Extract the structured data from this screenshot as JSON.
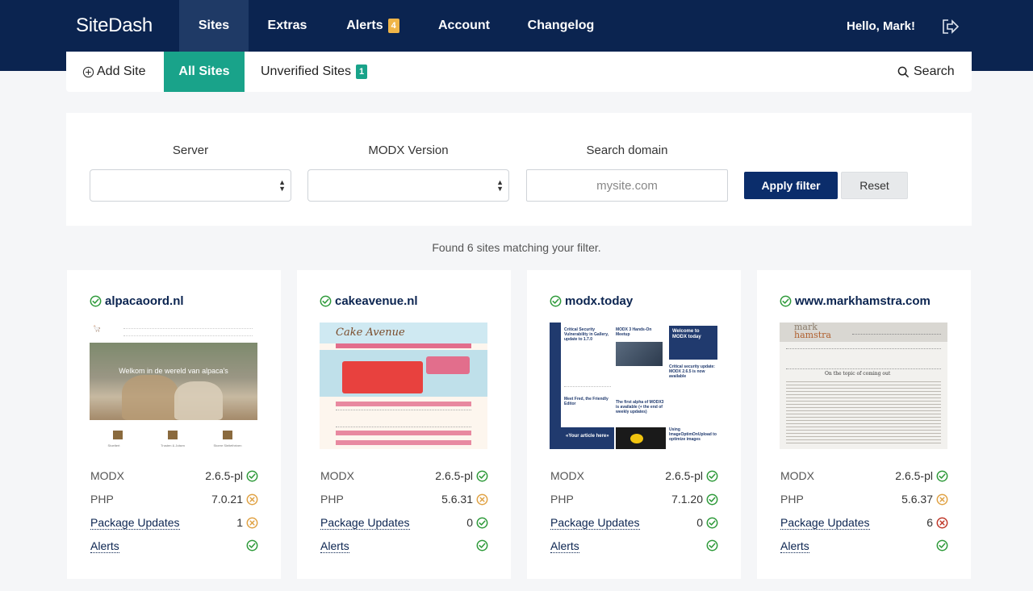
{
  "header": {
    "brand": "SiteDash",
    "nav": [
      {
        "label": "Sites",
        "active": true
      },
      {
        "label": "Extras"
      },
      {
        "label": "Alerts",
        "badge": "4"
      },
      {
        "label": "Account"
      },
      {
        "label": "Changelog"
      }
    ],
    "greeting": "Hello, Mark!"
  },
  "subnav": {
    "add_site": "Add Site",
    "all_sites": "All Sites",
    "unverified": "Unverified Sites",
    "unverified_count": "1",
    "search": "Search"
  },
  "filter": {
    "server_label": "Server",
    "modx_label": "MODX Version",
    "domain_label": "Search domain",
    "domain_placeholder": "mysite.com",
    "apply": "Apply filter",
    "reset": "Reset"
  },
  "found_text": "Found 6 sites matching your filter.",
  "row_labels": {
    "modx": "MODX",
    "php": "PHP",
    "updates": "Package Updates",
    "alerts": "Alerts"
  },
  "sites": [
    {
      "domain": "alpacaoord.nl",
      "modx": "2.6.5-pl",
      "modx_status": "ok",
      "php": "7.0.21",
      "php_status": "warn",
      "updates": "1",
      "updates_status": "warn",
      "alerts_status": "ok",
      "thumb_text": [
        "Welkom in de wereld van alpaca's",
        "Stoeltert",
        "Trusten & Jolsen",
        "Stoere Sleitethriven"
      ]
    },
    {
      "domain": "cakeavenue.nl",
      "modx": "2.6.5-pl",
      "modx_status": "ok",
      "php": "5.6.31",
      "php_status": "warn",
      "updates": "0",
      "updates_status": "ok",
      "alerts_status": "ok",
      "thumb_text": [
        "Cake Avenue"
      ]
    },
    {
      "domain": "modx.today",
      "modx": "2.6.5-pl",
      "modx_status": "ok",
      "php": "7.1.20",
      "php_status": "ok",
      "updates": "0",
      "updates_status": "ok",
      "alerts_status": "ok",
      "thumb_text": [
        "Critical Security Vulnerability in Gallery, update to 1.7.0",
        "MODX 3 Hands-On Meetup",
        "Welcome to MODX today",
        "Critical security update: MODX 2.6.5 is now available",
        "Meet Fred, the Friendly Editor",
        "The first alpha of MODX3 is available (+ the end of weekly updates)",
        "«Your article here»",
        "Using ImageOptimOnUpload to optimize images"
      ]
    },
    {
      "domain": "www.markhamstra.com",
      "modx": "2.6.5-pl",
      "modx_status": "ok",
      "php": "5.6.37",
      "php_status": "warn",
      "updates": "6",
      "updates_status": "error",
      "alerts_status": "ok",
      "thumb_text": [
        "mark",
        "hamstra",
        "On the topic of coming out"
      ]
    }
  ],
  "colors": {
    "navy": "#0b2450",
    "teal": "#19a38a",
    "ok": "#2e9a3a",
    "warn": "#e0a244",
    "error": "#c0392b"
  }
}
